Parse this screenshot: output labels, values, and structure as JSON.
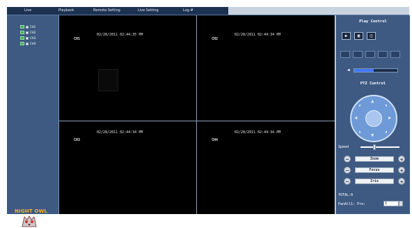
{
  "nav": {
    "items": [
      "Live",
      "Playback",
      "Remote Setting",
      "Live Setting",
      "Log #"
    ]
  },
  "channels": [
    "CH1",
    "CH2",
    "CH3",
    "CH4"
  ],
  "logo": {
    "text": "NIGHT OWL"
  },
  "video": {
    "tiles": [
      {
        "timestamp": "02/28/2011 02:44:35 PM",
        "label": "CH1"
      },
      {
        "timestamp": "02/28/2011 02:44:34 PM",
        "label": "CH2"
      },
      {
        "timestamp": "02/28/2011 02:44:34 PM",
        "label": "CH3"
      },
      {
        "timestamp": "02/28/2011 02:44:34 PM",
        "label": "CH4"
      }
    ]
  },
  "play_control": {
    "title": "Play Control",
    "volume_level": 0.45
  },
  "ptz": {
    "title": "PTZ Control",
    "speed_label": "Speed",
    "controls": [
      "Zoom",
      "Focus",
      "Iris"
    ],
    "total_label": "TOTAL:0",
    "preset_label": "PanAll1: Pre:",
    "preset_value": "1"
  },
  "colors": {
    "panel": "#3e5a82",
    "nav": "#1d3250",
    "video_bg": "#000000",
    "logo": "#ffb020",
    "volume_fill": "#3f78ff"
  }
}
